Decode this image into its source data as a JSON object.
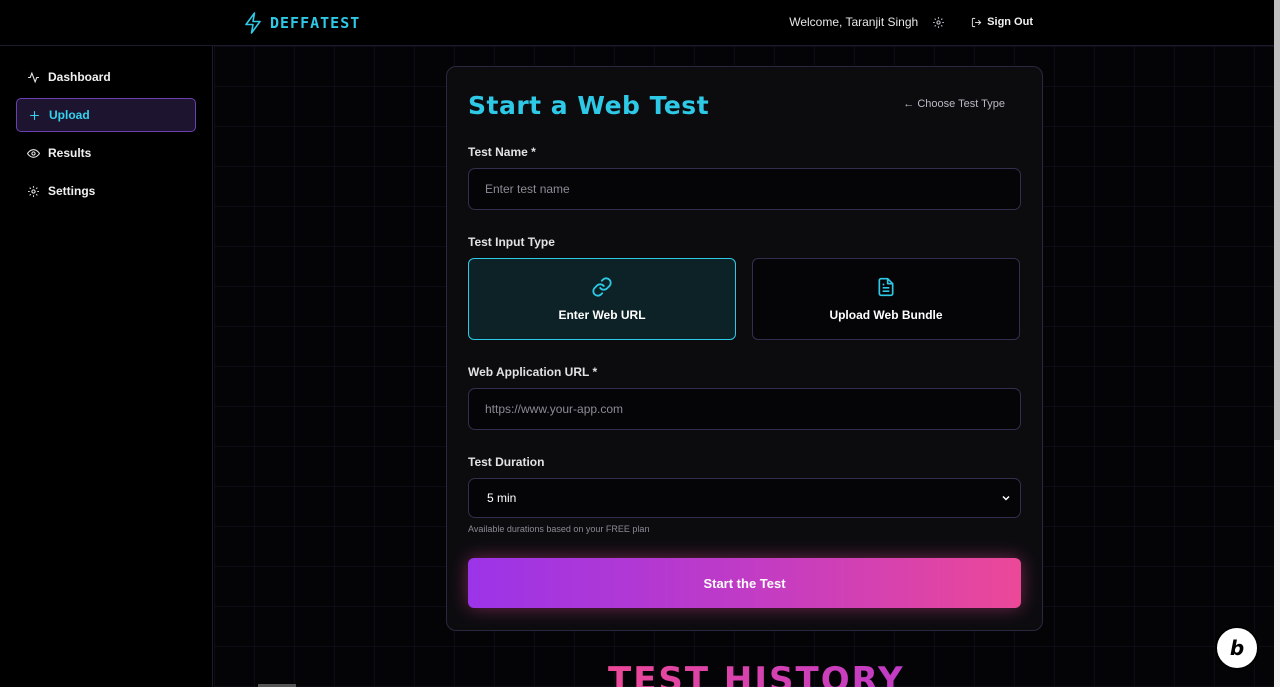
{
  "header": {
    "brand": "DEFFATEST",
    "welcome": "Welcome, Taranjit Singh",
    "signout_label": "Sign Out",
    "icons": {
      "logo": "lightning-icon",
      "settings": "gear-icon",
      "signout": "sign-out-icon"
    }
  },
  "sidebar": {
    "items": [
      {
        "label": "Dashboard",
        "icon": "activity-icon",
        "active": false
      },
      {
        "label": "Upload",
        "icon": "plus-icon",
        "active": true
      },
      {
        "label": "Results",
        "icon": "eye-icon",
        "active": false
      },
      {
        "label": "Settings",
        "icon": "gear-icon",
        "active": false
      }
    ]
  },
  "form": {
    "title": "Start a Web Test",
    "choose_type": "← Choose Test Type",
    "test_name_label": "Test Name *",
    "test_name_placeholder": "Enter test name",
    "input_type_label": "Test Input Type",
    "option_url": "Enter Web URL",
    "option_bundle": "Upload Web Bundle",
    "url_label": "Web Application URL *",
    "url_placeholder": "https://www.your-app.com",
    "duration_label": "Test Duration",
    "duration_value": "5 min",
    "duration_hint": "Available durations based on your FREE plan",
    "submit_label": "Start the Test"
  },
  "history": {
    "title": "TEST HISTORY"
  },
  "colors": {
    "accent": "#2ec9e6",
    "gradient_start": "#9b34e8",
    "gradient_end": "#ec4898"
  }
}
